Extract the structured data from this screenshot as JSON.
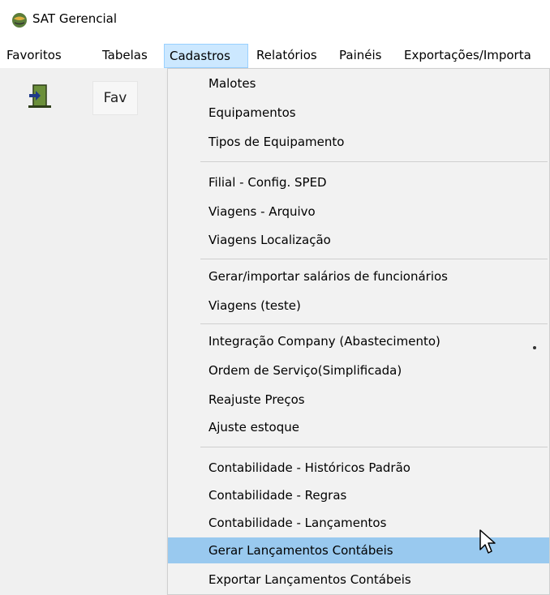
{
  "window": {
    "title": "SAT Gerencial"
  },
  "menubar": {
    "items": [
      {
        "label": "Favoritos"
      },
      {
        "label": "Tabelas"
      },
      {
        "label": "Cadastros"
      },
      {
        "label": "Relatórios"
      },
      {
        "label": "Painéis"
      },
      {
        "label": "Exportações/Importa"
      }
    ],
    "active": "Cadastros"
  },
  "toolbar": {
    "fav_label": "Fav"
  },
  "dropdown": {
    "items": [
      {
        "label": "Malotes"
      },
      {
        "label": "Equipamentos"
      },
      {
        "label": "Tipos de Equipamento"
      },
      {
        "label": "Filial - Config. SPED"
      },
      {
        "label": "Viagens - Arquivo"
      },
      {
        "label": "Viagens Localização"
      },
      {
        "label": "Gerar/importar salários de funcionários"
      },
      {
        "label": "Viagens (teste)"
      },
      {
        "label": "Integração Company (Abastecimento)"
      },
      {
        "label": "Ordem de Serviço(Simplificada)"
      },
      {
        "label": "Reajuste Preços"
      },
      {
        "label": "Ajuste estoque"
      },
      {
        "label": "Contabilidade - Históricos Padrão"
      },
      {
        "label": "Contabilidade - Regras"
      },
      {
        "label": "Contabilidade - Lançamentos"
      },
      {
        "label": "Gerar Lançamentos Contábeis"
      },
      {
        "label": "Exportar Lançamentos Contábeis"
      }
    ],
    "highlighted": "Gerar Lançamentos Contábeis"
  },
  "colors": {
    "menu_active_bg": "#cce8ff",
    "dropdown_bg": "#f2f2f2",
    "highlight_bg": "#99c9ef",
    "toolbar_bg": "#f0f0f0"
  },
  "icons": {
    "app": "sat-globe-icon",
    "exit": "exit-door-icon",
    "cursor": "mouse-pointer-icon"
  }
}
